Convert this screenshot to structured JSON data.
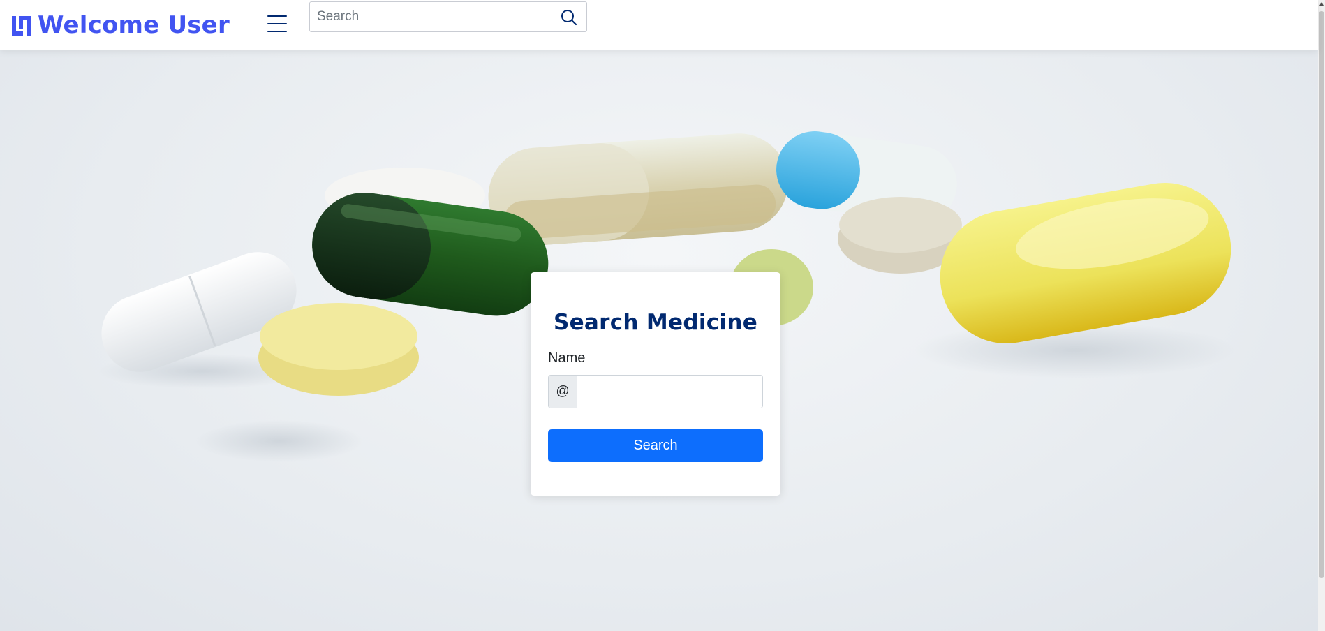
{
  "header": {
    "brand_text": "Welcome User",
    "search": {
      "placeholder": "Search",
      "value": ""
    },
    "brand_color": "#4154f1",
    "nav_color": "#012970"
  },
  "search_card": {
    "title": "Search Medicine",
    "field_label": "Name",
    "addon": "@",
    "input_value": "",
    "submit_label": "Search",
    "button_color": "#0d6efd"
  },
  "hero_image": {
    "subject": "pills-and-capsules"
  }
}
